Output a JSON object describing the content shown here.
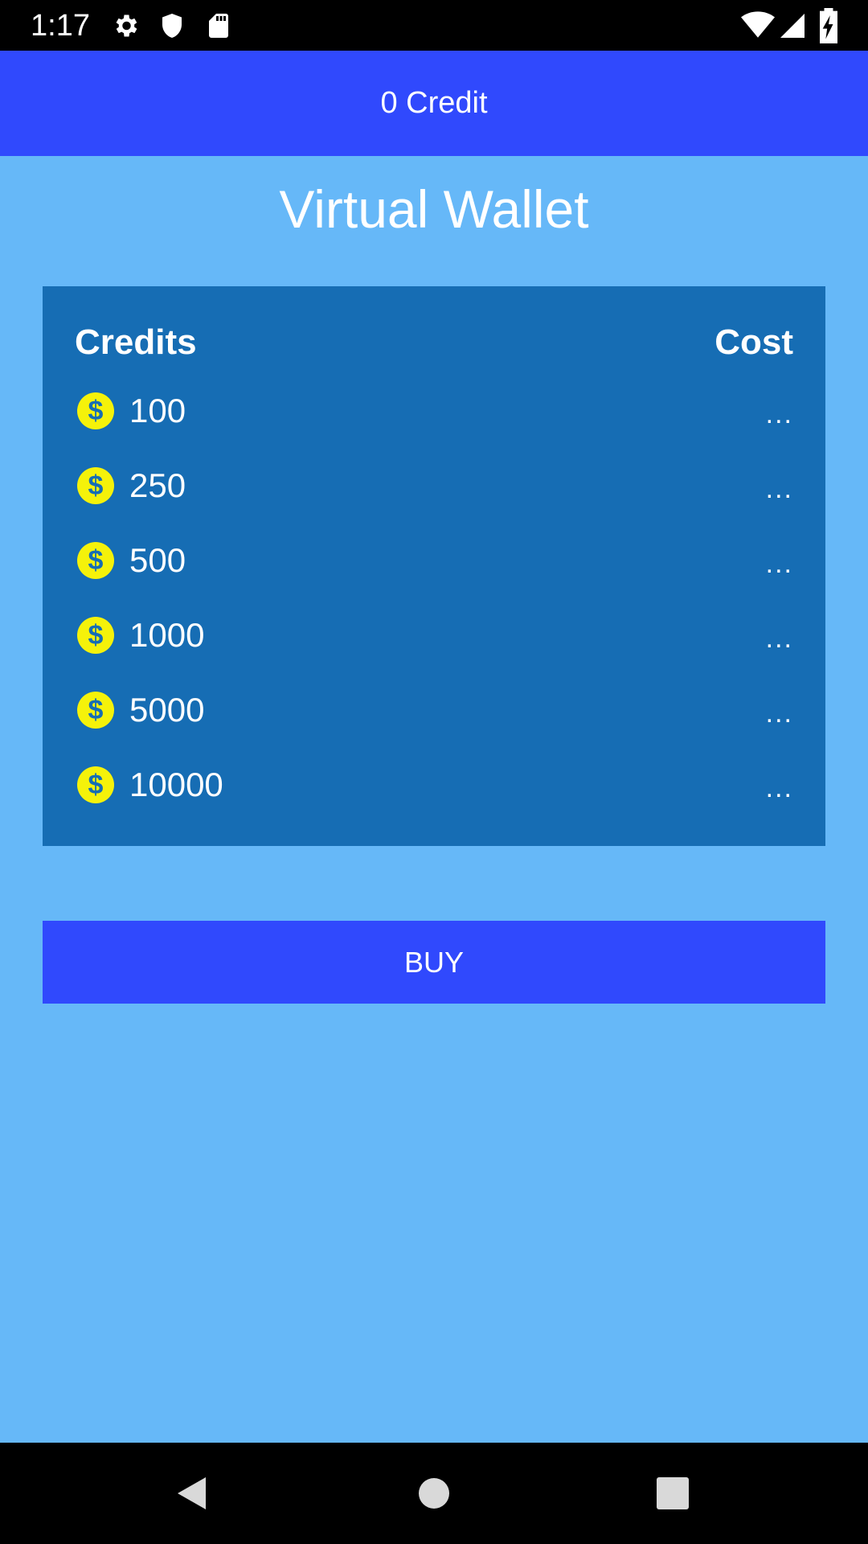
{
  "status_bar": {
    "time": "1:17",
    "left_icons": [
      "gear-icon",
      "shield-icon",
      "sd-card-icon"
    ],
    "right_icons": [
      "wifi-icon",
      "cell-signal-icon",
      "battery-charging-icon"
    ]
  },
  "header": {
    "credit_label": "0 Credit"
  },
  "title": "Virtual Wallet",
  "table": {
    "columns": [
      "Credits",
      "Cost"
    ],
    "rows": [
      {
        "credits": "100",
        "cost": "..."
      },
      {
        "credits": "250",
        "cost": "..."
      },
      {
        "credits": "500",
        "cost": "..."
      },
      {
        "credits": "1000",
        "cost": "..."
      },
      {
        "credits": "5000",
        "cost": "..."
      },
      {
        "credits": "10000",
        "cost": "..."
      }
    ]
  },
  "buy_button": {
    "label": "BUY"
  },
  "nav_bar": {
    "buttons": [
      "back-icon",
      "home-icon",
      "recents-icon"
    ]
  },
  "colors": {
    "background": "#66b8f8",
    "accent": "#3049fd",
    "panel": "#166db4",
    "coin": "#f5f20a"
  }
}
